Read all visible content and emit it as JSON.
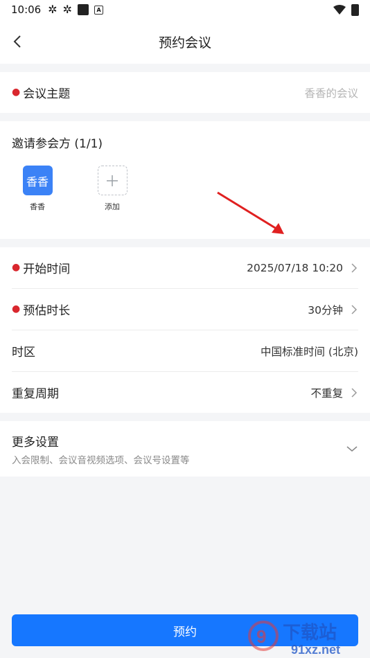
{
  "status_bar": {
    "time": "10:06"
  },
  "navbar": {
    "title": "预约会议"
  },
  "topic": {
    "label": "会议主题",
    "placeholder": "香香的会议"
  },
  "invite": {
    "title": "邀请参会方 (1/1)",
    "participants": [
      {
        "avatar_text": "香香",
        "name": "香香"
      }
    ],
    "add_label": "添加"
  },
  "schedule": {
    "start": {
      "label": "开始时间",
      "value": "2025/07/18 10:20"
    },
    "duration": {
      "label": "预估时长",
      "value": "30分钟"
    },
    "timezone": {
      "label": "时区",
      "value": "中国标准时间 (北京)"
    },
    "repeat": {
      "label": "重复周期",
      "value": "不重复"
    }
  },
  "more": {
    "title": "更多设置",
    "subtitle": "入会限制、会议音视频选项、会议号设置等"
  },
  "submit": {
    "label": "预约"
  },
  "watermark": {
    "brand": "下载站",
    "domain": "91xz.net"
  },
  "colors": {
    "primary": "#1677ff",
    "required": "#d9272e",
    "avatar": "#3b82f6",
    "annotation_arrow": "#e02020"
  }
}
